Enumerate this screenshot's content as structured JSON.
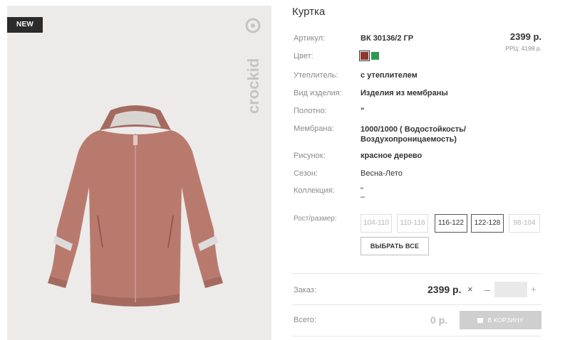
{
  "product": {
    "badge": "NEW",
    "brand": "crockid",
    "title": "Куртка",
    "price": "2399 р.",
    "rrc": "РРЦ: 4199 р."
  },
  "colors": {
    "accent": "#2b2b2b",
    "swatches": [
      "#8a3a2c",
      "#2e9a4f"
    ],
    "jacket": "#b97a6e"
  },
  "specs": {
    "article": {
      "label": "Артикул:",
      "value": "ВК 30136/2 ГР"
    },
    "color": {
      "label": "Цвет:"
    },
    "insulation": {
      "label": "Утеплитель:",
      "value": "с утеплителем"
    },
    "type": {
      "label": "Вид изделия:",
      "value": "Изделия из мембраны"
    },
    "fabric": {
      "label": "Полотно:",
      "value": "\""
    },
    "membrane": {
      "label": "Мембрана:",
      "value": "1000/1000 ( Водостойкость/ Воздухопроницаемость)"
    },
    "pattern": {
      "label": "Рисунок:",
      "value": "красное дерево"
    },
    "season": {
      "label": "Сезон:",
      "value": "Весна-Лето"
    },
    "collection": {
      "label": "Коллекция:",
      "value": "\"",
      "value2": "–"
    },
    "size": {
      "label": "Рост/размер:"
    }
  },
  "sizes": [
    {
      "label": "104-110",
      "available": false
    },
    {
      "label": "110-116",
      "available": false
    },
    {
      "label": "116-122",
      "available": true
    },
    {
      "label": "122-128",
      "available": true
    },
    {
      "label": "98-104",
      "available": false
    }
  ],
  "select_all": "ВЫБРАТЬ ВСЕ",
  "order": {
    "label": "Заказ:",
    "price": "2399 р.",
    "times": "×",
    "minus": "–",
    "plus": "+",
    "quantity": ""
  },
  "total": {
    "label": "Всего:",
    "price": "0 р.",
    "cart_button": "В КОРЗИНУ"
  }
}
